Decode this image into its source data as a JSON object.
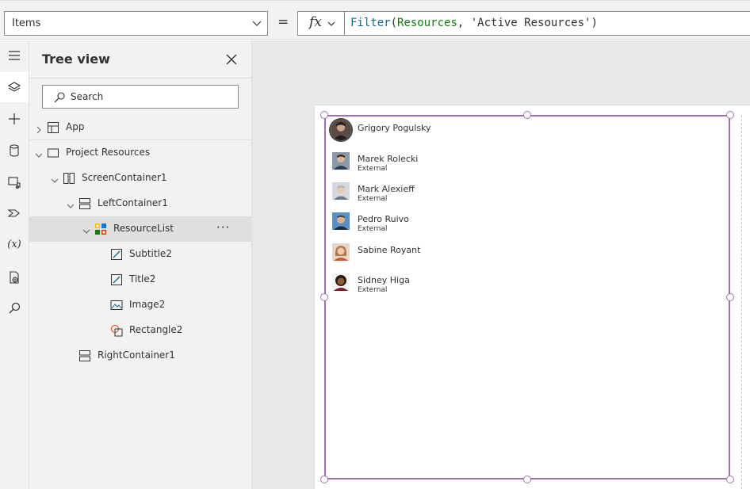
{
  "formula_bar": {
    "property": "Items",
    "equals": "=",
    "fx": "fx",
    "formula_tokens": [
      {
        "text": "Filter",
        "kind": "fn"
      },
      {
        "text": "(",
        "kind": "p"
      },
      {
        "text": "Resources",
        "kind": "id"
      },
      {
        "text": ", ",
        "kind": "p"
      },
      {
        "text": "'Active Resources'",
        "kind": "str"
      },
      {
        "text": ")",
        "kind": "p"
      }
    ]
  },
  "rail": {
    "items": [
      {
        "icon": "hamburger-icon"
      },
      {
        "icon": "layers-icon",
        "active": true
      },
      {
        "icon": "plus-icon"
      },
      {
        "icon": "database-icon"
      },
      {
        "icon": "media-icon"
      },
      {
        "icon": "power-automate-icon"
      },
      {
        "icon": "variables-icon",
        "text": "(x)"
      },
      {
        "icon": "advanced-tools-icon"
      },
      {
        "icon": "search-icon"
      }
    ]
  },
  "tree": {
    "title": "Tree view",
    "search_placeholder": "Search",
    "nodes": [
      {
        "label": "App",
        "depth": 0,
        "caret": "right",
        "icon": "app-icon"
      },
      {
        "label": "Project Resources",
        "depth": 0,
        "caret": "down",
        "icon": "screen-icon"
      },
      {
        "label": "ScreenContainer1",
        "depth": 1,
        "caret": "down",
        "icon": "horizontal-container-icon"
      },
      {
        "label": "LeftContainer1",
        "depth": 2,
        "caret": "down",
        "icon": "vertical-container-icon"
      },
      {
        "label": "ResourceList",
        "depth": 3,
        "caret": "down",
        "icon": "gallery-icon",
        "selected": true,
        "more": "···"
      },
      {
        "label": "Subtitle2",
        "depth": 4,
        "caret": "",
        "icon": "label-icon"
      },
      {
        "label": "Title2",
        "depth": 4,
        "caret": "",
        "icon": "label-icon"
      },
      {
        "label": "Image2",
        "depth": 4,
        "caret": "",
        "icon": "image-icon"
      },
      {
        "label": "Rectangle2",
        "depth": 4,
        "caret": "",
        "icon": "shape-icon"
      },
      {
        "label": "RightContainer1",
        "depth": 2,
        "caret": "",
        "icon": "vertical-container-icon"
      }
    ]
  },
  "gallery": {
    "items": [
      {
        "name": "Grigory Pogulsky",
        "subtitle": "",
        "avatar": "dark"
      },
      {
        "name": "Marek Rolecki",
        "subtitle": "External",
        "avatar": "man"
      },
      {
        "name": "Mark Alexieff",
        "subtitle": "External",
        "avatar": "grey"
      },
      {
        "name": "Pedro Ruivo",
        "subtitle": "External",
        "avatar": "blue"
      },
      {
        "name": "Sabine Royant",
        "subtitle": "",
        "avatar": "woman"
      },
      {
        "name": "Sidney Higa",
        "subtitle": "External",
        "avatar": "woman2"
      }
    ]
  },
  "colors": {
    "accent": "#9e73a9",
    "formula_function": "#0f6a8c",
    "formula_identifier": "#107c10"
  }
}
